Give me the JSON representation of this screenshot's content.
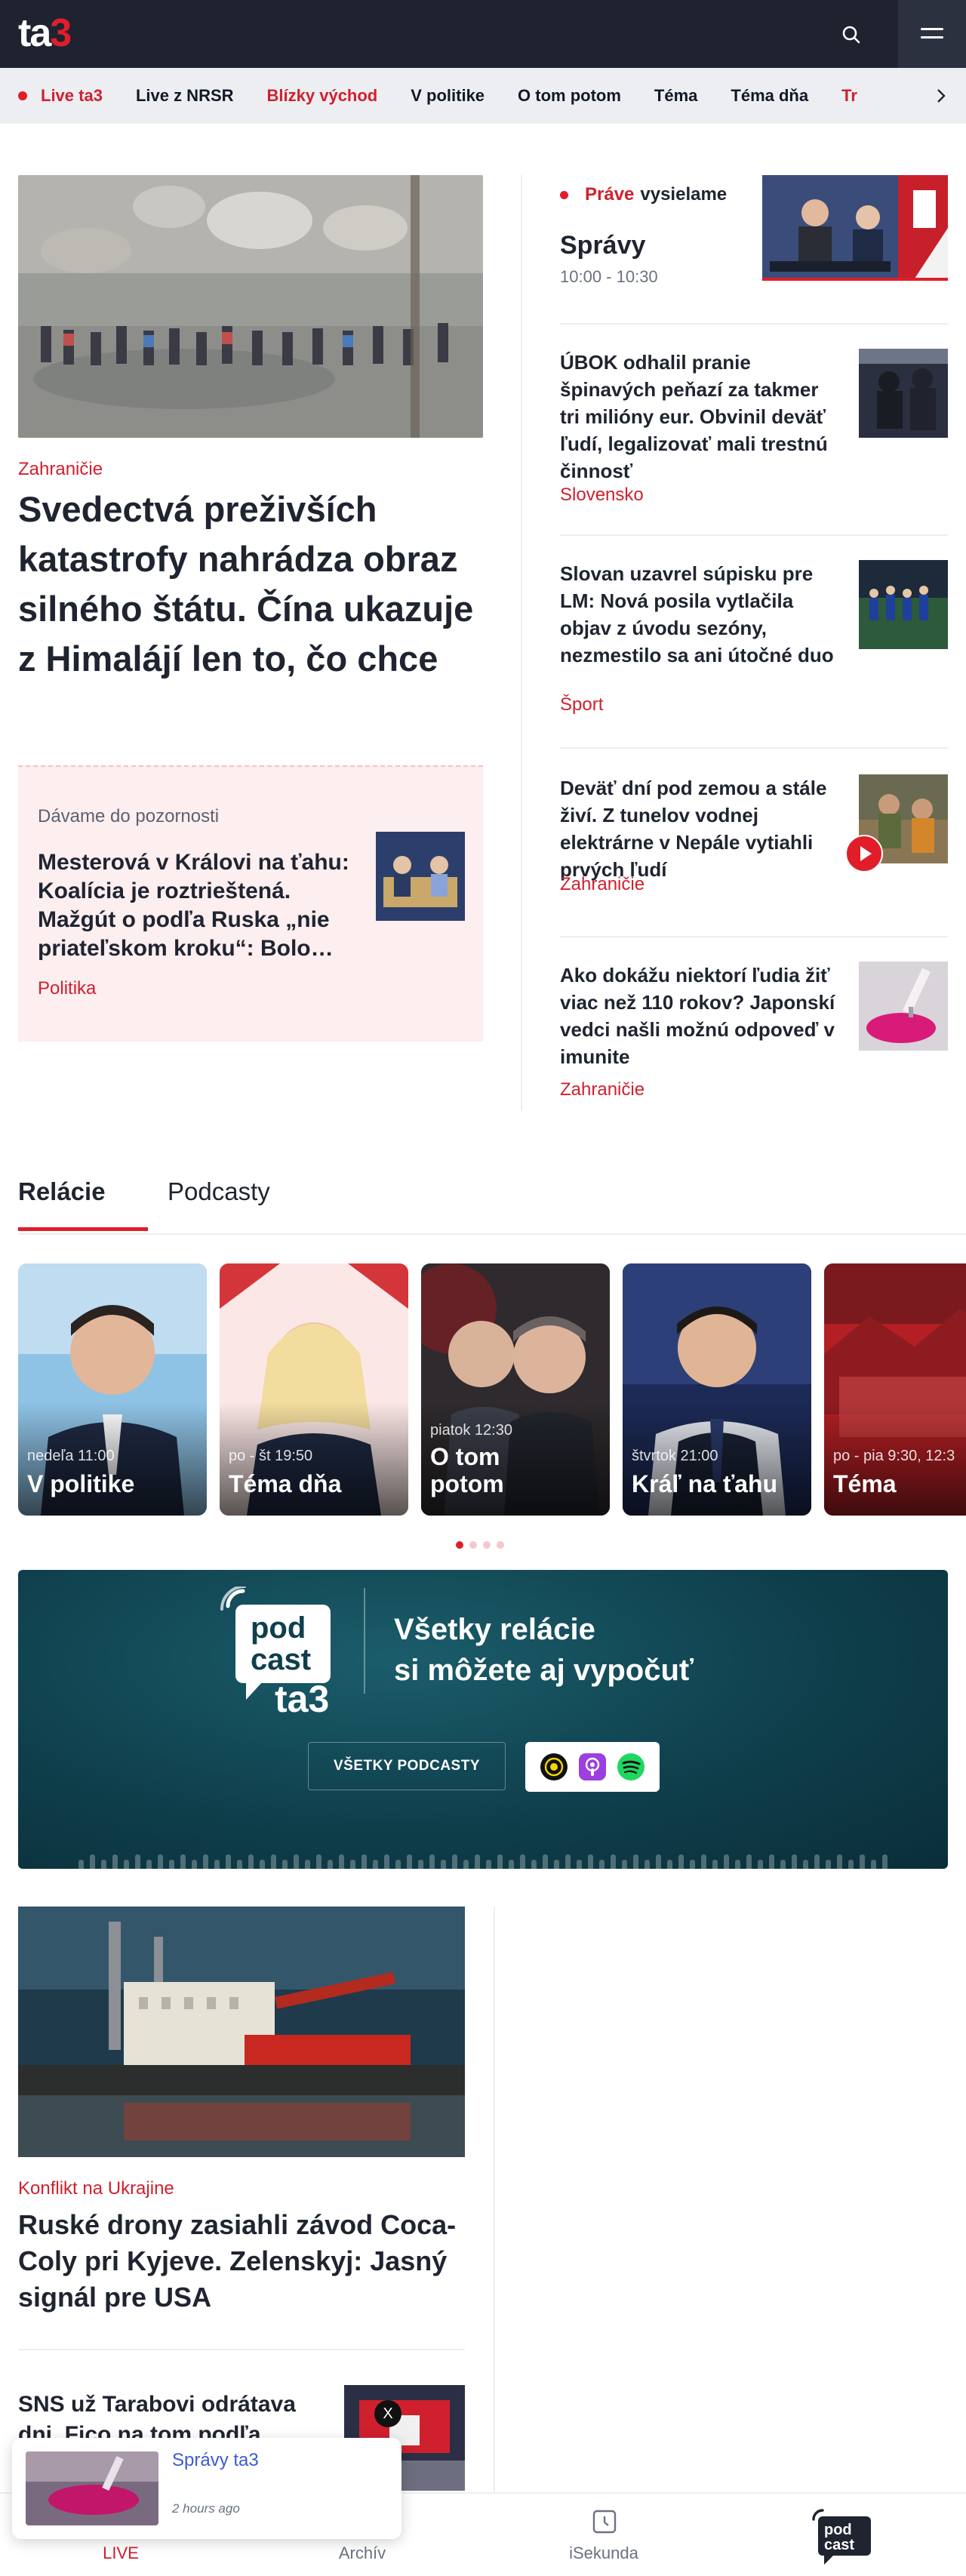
{
  "header": {
    "logo": {
      "text_white": "ta",
      "text_red": "3"
    },
    "search_icon": "search-icon",
    "menu_icon": "hamburger-menu-icon"
  },
  "nav": {
    "items": [
      {
        "label": "Live ta3",
        "style": "red",
        "live_dot": true
      },
      {
        "label": "Live z NRSR",
        "style": "normal"
      },
      {
        "label": "Blízky východ",
        "style": "red"
      },
      {
        "label": "V politike",
        "style": "normal"
      },
      {
        "label": "O tom potom",
        "style": "normal"
      },
      {
        "label": "Téma",
        "style": "normal"
      },
      {
        "label": "Téma dňa",
        "style": "normal"
      },
      {
        "label": "Tr",
        "style": "red"
      }
    ],
    "next_icon": "chevron-right-icon"
  },
  "hero": {
    "category": "Zahraničie",
    "title": "Svedectvá preživších katastrofy nahrádza obraz silného štátu. Čína ukazuje z Himalájí len to, čo chce"
  },
  "promo": {
    "label": "Dávame do pozornosti",
    "title": "Mesterová v Královi na ťahu: Koalícia je roztrieštená. Mažgút o podľa Ruska „nie priateľskom kroku“: Bolo…",
    "category": "Politika"
  },
  "live": {
    "prefix": "Práve",
    "suffix": "vysielame",
    "show": "Správy",
    "time": "10:00 - 10:30"
  },
  "side_articles": [
    {
      "title": "ÚBOK odhalil pranie špinavých peňazí za takmer tri milióny eur. Obvinil deväť ľudí, legalizovať mali trestnú činnosť",
      "category": "Slovensko"
    },
    {
      "title": "Slovan uzavrel súpisku pre LM: Nová posila vytlačila objav z úvodu sezóny, nezmestilo sa ani útočné duo",
      "category": "Šport"
    },
    {
      "title": "Deväť dní pod zemou a stále živí. Z tunelov vodnej elektrárne v Nepále vytiahli prvých ľudí",
      "category": "Zahraničie",
      "has_video": true
    },
    {
      "title": "Ako dokážu niektorí ľudia žiť viac než 110 rokov? Japonskí vedci našli možnú odpoveď v imunite",
      "category": "Zahraničie"
    }
  ],
  "tabs": [
    {
      "label": "Relácie",
      "active": true
    },
    {
      "label": "Podcasty",
      "active": false
    }
  ],
  "shows": [
    {
      "schedule": "nedeľa 11:00",
      "name": "V politike",
      "bg": "#7fb9df"
    },
    {
      "schedule": "po - št 19:50",
      "name": "Téma dňa",
      "bg": "#d63a3a"
    },
    {
      "schedule": "piatok 12:30",
      "name_line1": "O tom",
      "name_line2": "potom",
      "bg": "#3a3234"
    },
    {
      "schedule": "štvrtok 21:00",
      "name": "Kráľ na ťahu",
      "bg": "#1e2a55"
    },
    {
      "schedule": "po - pia 9:30, 12:3",
      "name": "Téma",
      "bg": "#b31f24"
    }
  ],
  "carousel": {
    "count": 4,
    "active": 0
  },
  "podcast_banner": {
    "logo_line1": "pod",
    "logo_line2": "cast",
    "logo_line3": "ta3",
    "headline_line1": "Všetky relácie",
    "headline_line2": "si môžete aj vypočuť",
    "button": "VŠETKY PODCASTY",
    "apps": [
      "podcast-app-icon",
      "apple-podcasts-icon",
      "spotify-icon"
    ]
  },
  "lower_article": {
    "category": "Konflikt na Ukrajine",
    "title": "Ruské drony zasiahli závod Coca-Coly pri Kyjeve. Zelenskyj: Jasný signál pre USA"
  },
  "lower_article2": {
    "title": "SNS už Tarabovi odrátava dni. Fico na tom podľa"
  },
  "mini_player": {
    "title": "Správy ta3",
    "time": "2 hours ago",
    "close": "X"
  },
  "bottom_nav": [
    {
      "label": "LIVE",
      "icon": "live-icon",
      "active": true
    },
    {
      "label": "Archív",
      "icon": "archive-icon",
      "active": false
    },
    {
      "label": "iSekunda",
      "icon": "clock-icon",
      "active": false
    },
    {
      "label": "podcast",
      "icon": "podcast-logo-icon",
      "active": false
    }
  ],
  "colors": {
    "brand_red": "#e11d2a",
    "header_dark": "#1f2330",
    "nav_bg": "#eceef1",
    "promo_bg": "#fdeef0",
    "podcast_teal": "#0f3f4c"
  }
}
